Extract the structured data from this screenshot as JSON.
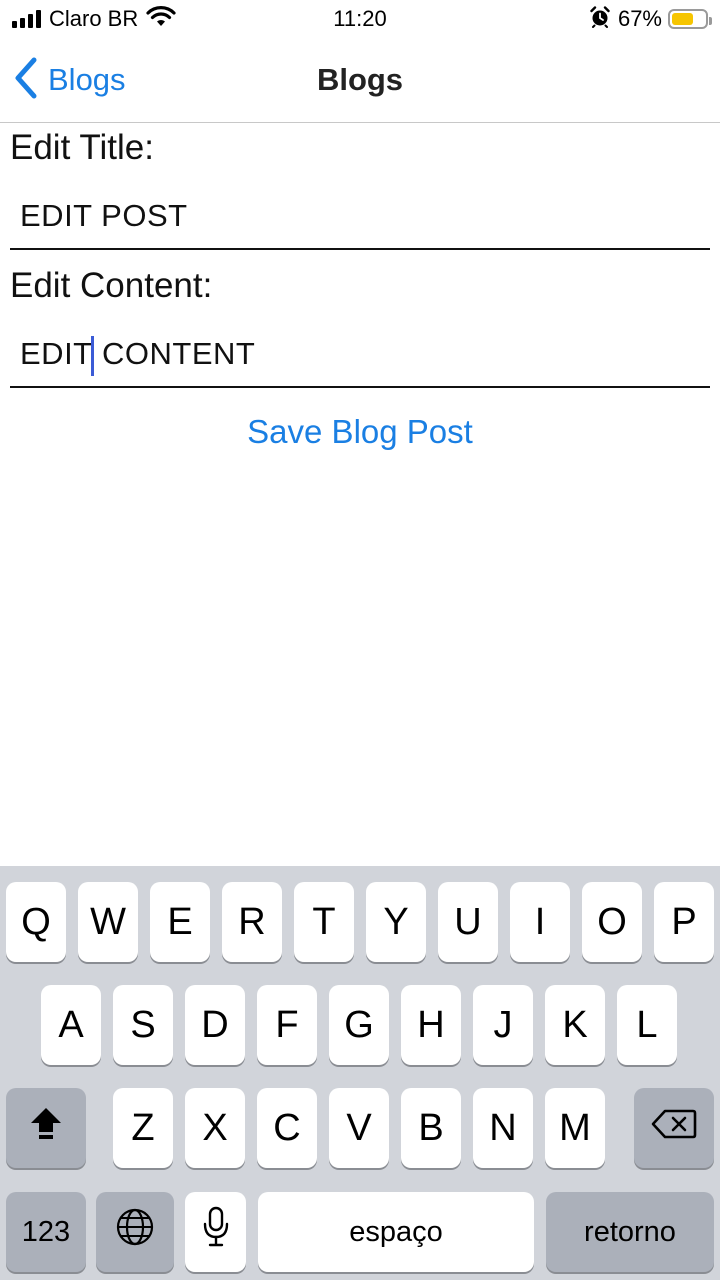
{
  "status_bar": {
    "carrier": "Claro BR",
    "time": "11:20",
    "battery_percent": "67%",
    "battery_level": 0.67,
    "icons": [
      "signal-icon",
      "wifi-icon",
      "alarm-icon",
      "battery-icon"
    ]
  },
  "nav": {
    "back_label": "Blogs",
    "title": "Blogs"
  },
  "form": {
    "title_label": "Edit Title:",
    "title_value": "EDIT POST",
    "content_label": "Edit Content:",
    "content_value_before_cursor": "EDIT",
    "content_value_after_cursor": "CONTENT",
    "save_label": "Save Blog Post"
  },
  "keyboard": {
    "row1": [
      "Q",
      "W",
      "E",
      "R",
      "T",
      "Y",
      "U",
      "I",
      "O",
      "P"
    ],
    "row2": [
      "A",
      "S",
      "D",
      "F",
      "G",
      "H",
      "J",
      "K",
      "L"
    ],
    "row3": [
      "Z",
      "X",
      "C",
      "V",
      "B",
      "N",
      "M"
    ],
    "numbers_label": "123",
    "space_label": "espaço",
    "return_label": "retorno"
  },
  "colors": {
    "accent": "#1a7fe3",
    "cursor": "#3b5bd6",
    "battery": "#f6c500",
    "keyboard_bg": "#d1d4da"
  }
}
